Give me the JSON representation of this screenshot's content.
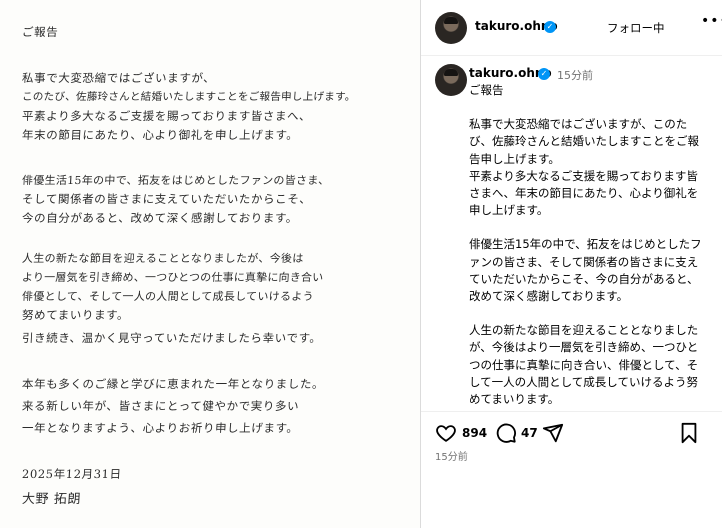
{
  "letter": {
    "lines": [
      "ご報告",
      "私事で大変恐縮ではございますが、",
      "このたび、佐藤玲さんと結婚いたしますことをご報告申し上げます。",
      "平素より多大なるご支援を賜っております皆さまへ、",
      "年末の節目にあたり、心より御礼を申し上げます。",
      "俳優生活15年の中で、拓友をはじめとしたファンの皆さま、",
      "そして関係者の皆さまに支えていただいたからこそ、",
      "今の自分があると、改めて深く感謝しております。",
      "人生の新たな節目を迎えることとなりましたが、今後は",
      "より一層気を引き締め、一つひとつの仕事に真摯に向き合い",
      "俳優として、そして一人の人間として成長していけるよう",
      "努めてまいります。",
      "引き続き、温かく見守っていただけましたら幸いです。",
      "本年も多くのご縁と学びに恵まれた一年となりました。",
      "来る新しい年が、皆さまにとって健やかで実り多い",
      "一年となりますよう、心よりお祈り申し上げます。",
      "2025年12月31日",
      "大野 拓朗"
    ]
  },
  "header": {
    "username": "takuro.ohno",
    "verified_badge": "✓",
    "follow_label": "フォロー中",
    "more_label": "•••"
  },
  "caption": {
    "username": "takuro.ohno",
    "time_ago": "15分前",
    "paragraphs": [
      "ご報告",
      "私事で大変恐縮ではございますが、このたび、佐藤玲さんと結婚いたしますことをご報告申し上げます。\n平素より多大なるご支援を賜っております皆さまへ、年末の節目にあたり、心より御礼を申し上げます。",
      "俳優生活15年の中で、拓友をはじめとしたファンの皆さま、そして関係者の皆さまに支えていただいたからこそ、今の自分があると、改めて深く感謝しております。",
      "人生の新たな節目を迎えることとなりましたが、今後はより一層気を引き締め、一つひとつの仕事に真摯に向き合い、俳優として、そして一人の人間として成長していけるよう努めてまいります。\n引き続き、温かく見守っていただけまし"
    ]
  },
  "actions": {
    "like_count": "894",
    "comment_count": "47",
    "post_time": "15分前",
    "icons": [
      "heart-icon",
      "comment-icon",
      "share-icon",
      "bookmark-icon"
    ]
  },
  "colors": {
    "verified": "#0095f6",
    "muted_text": "#737373",
    "divider": "#dbdbdb"
  }
}
